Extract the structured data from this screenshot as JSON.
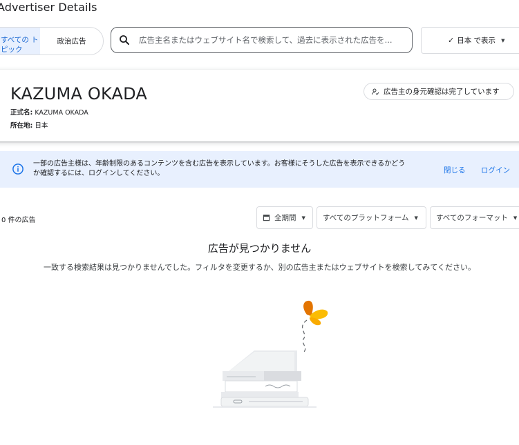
{
  "header": {
    "title": "Advertiser Details"
  },
  "topics": {
    "all_label": "すべての トピック",
    "political_label": "政治広告"
  },
  "search": {
    "placeholder": "広告主名またはウェブサイト名で検索して、過去に表示された広告を..."
  },
  "region": {
    "label": "日本 で表示"
  },
  "advertiser": {
    "name": "KAZUMA OKADA",
    "legal_name_label": "正式名:",
    "legal_name": "KAZUMA OKADA",
    "location_label": "所在地:",
    "location": "日本",
    "verification": "広告主の身元確認は完了しています"
  },
  "banner": {
    "text": "一部の広告主様は、年齢制限のあるコンテンツを含む広告を表示しています。お客様にそうした広告を表示できるかどうか確認するには、ログインしてください。",
    "close_label": "閉じる",
    "login_label": "ログイン"
  },
  "results": {
    "count_label": "0 件の広告",
    "filters": {
      "date": "全期間",
      "platform": "すべてのプラットフォーム",
      "format": "すべてのフォーマット"
    }
  },
  "empty": {
    "title": "広告が見つかりません",
    "message": "一致する検索結果は見つかりませんでした。フィルタを変更するか、別の広告主またはウェブサイトを検索してみてください。"
  },
  "colors": {
    "accent": "#1a73e8",
    "banner_bg": "#e8f0fe",
    "butterfly": "#f9ab00"
  }
}
